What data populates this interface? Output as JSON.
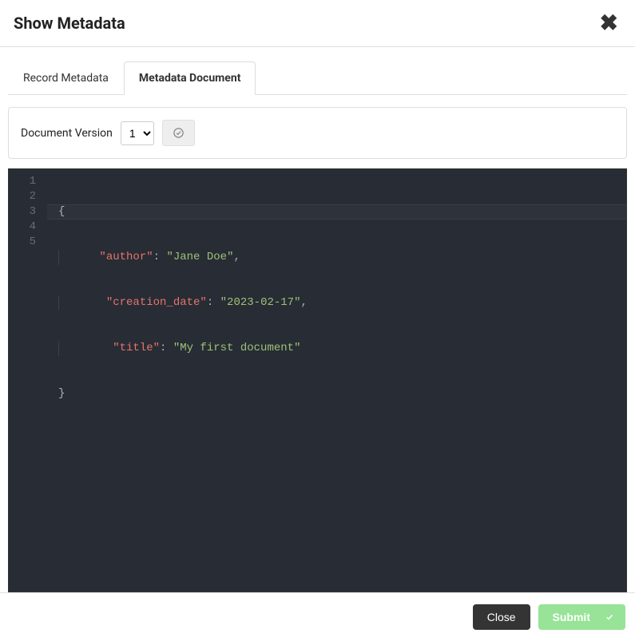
{
  "header": {
    "title": "Show Metadata"
  },
  "tabs": {
    "record": "Record Metadata",
    "document": "Metadata Document"
  },
  "toolbar": {
    "version_label": "Document Version",
    "selected_version": "1"
  },
  "code": {
    "line1": "{",
    "k_author": "\"author\"",
    "v_author": "\"Jane Doe\"",
    "k_creation": "\"creation_date\"",
    "v_creation": "\"2023-02-17\"",
    "k_title": "\"title\"",
    "v_title": "\"My first document\"",
    "colon": ": ",
    "comma": ",",
    "line5": "}"
  },
  "gutter": {
    "l1": "1",
    "l2": "2",
    "l3": "3",
    "l4": "4",
    "l5": "5"
  },
  "footer": {
    "close_label": "Close",
    "submit_label": "Submit"
  }
}
